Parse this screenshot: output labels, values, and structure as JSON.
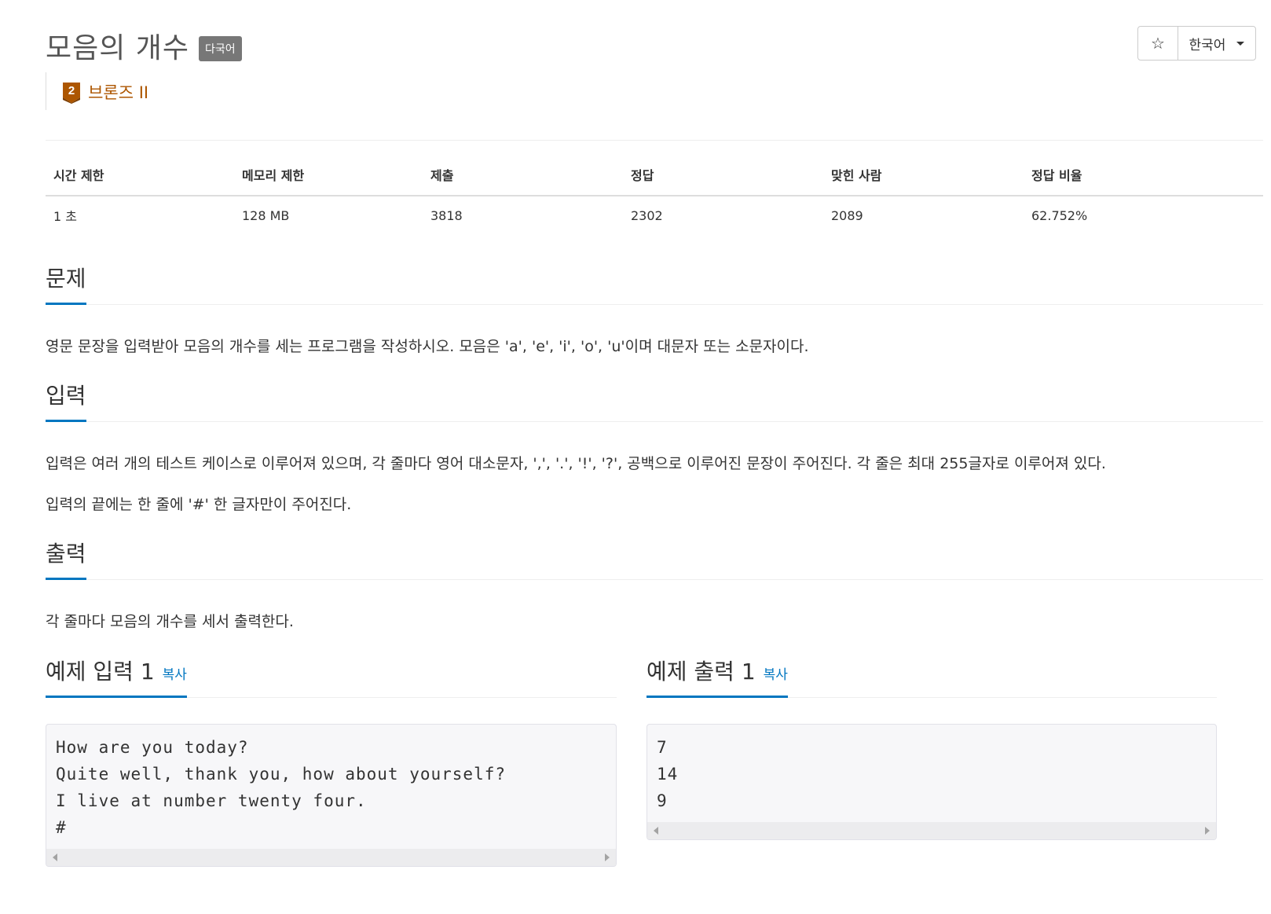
{
  "header": {
    "title": "모음의 개수",
    "language_label": "다국어",
    "tier": {
      "level": "2",
      "text": "브론즈 II",
      "color": "#ad5600"
    },
    "star_icon": "☆",
    "language_select": "한국어"
  },
  "info_table": {
    "headers": [
      "시간 제한",
      "메모리 제한",
      "제출",
      "정답",
      "맞힌 사람",
      "정답 비율"
    ],
    "values": [
      "1 초",
      "128 MB",
      "3818",
      "2302",
      "2089",
      "62.752%"
    ]
  },
  "problem": {
    "title": "문제",
    "text": "영문 문장을 입력받아 모음의 개수를 세는 프로그램을 작성하시오. 모음은 'a', 'e', 'i', 'o', 'u'이며 대문자 또는 소문자이다."
  },
  "input": {
    "title": "입력",
    "text1": "입력은 여러 개의 테스트 케이스로 이루어져 있으며, 각 줄마다 영어 대소문자, ',', '.', '!', '?', 공백으로 이루어진 문장이 주어진다. 각 줄은 최대 255글자로 이루어져 있다.",
    "text2": "입력의 끝에는 한 줄에 '#' 한 글자만이 주어진다."
  },
  "output": {
    "title": "출력",
    "text": "각 줄마다 모음의 개수를 세서 출력한다."
  },
  "sample_input": {
    "title": "예제 입력 1",
    "copy_label": "복사",
    "content": "How are you today?\nQuite well, thank you, how about yourself?\nI live at number twenty four.\n#"
  },
  "sample_output": {
    "title": "예제 출력 1",
    "copy_label": "복사",
    "content": "7\n14\n9"
  },
  "colors": {
    "accent": "#0076c0",
    "bronze": "#ad5600",
    "label_bg": "#777777"
  }
}
